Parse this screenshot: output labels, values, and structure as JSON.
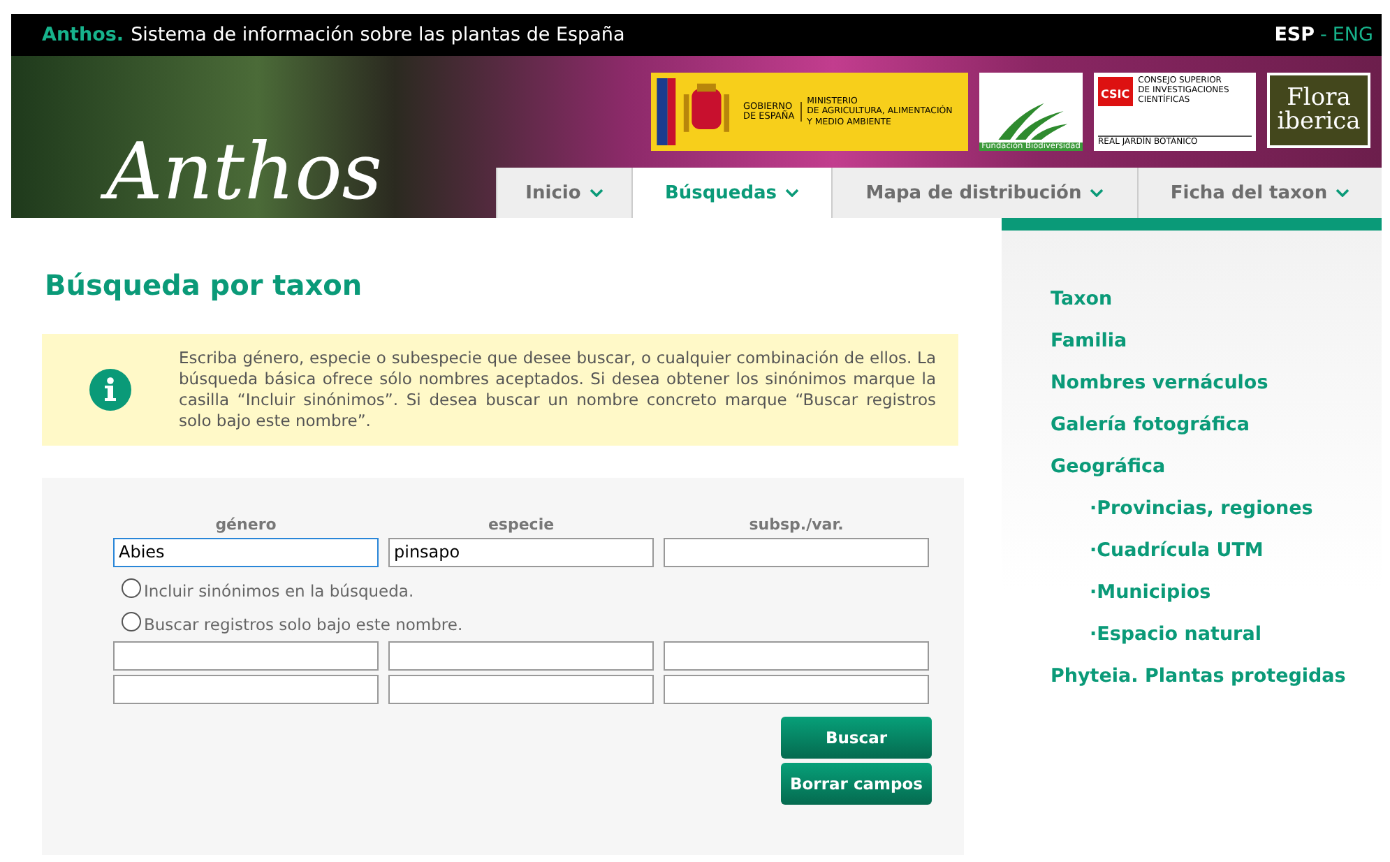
{
  "top_bar": {
    "brand": "Anthos.",
    "tagline": "Sistema de información sobre las plantas de España",
    "languages": [
      {
        "label": "ESP",
        "selected": true
      },
      {
        "label": "ENG",
        "selected": false
      }
    ],
    "separator": "-"
  },
  "banner": {
    "script_title": "Anthos",
    "logos": [
      {
        "kind": "gobierno",
        "lines": [
          "GOBIERNO",
          "DE ESPAÑA"
        ],
        "ministry": [
          "MINISTERIO",
          "DE AGRICULTURA, ALIMENTACIÓN",
          "Y MEDIO AMBIENTE"
        ]
      },
      {
        "kind": "fundacion",
        "caption": "Fundación Biodiversidad"
      },
      {
        "kind": "csic",
        "badge": "CSIC",
        "lines": [
          "CONSEJO SUPERIOR",
          "DE INVESTIGACIONES",
          "CIENTÍFICAS"
        ],
        "caption": "REAL JARDÍN BOTÁNICO"
      },
      {
        "kind": "flora",
        "lines": [
          "Flora",
          "iberica"
        ]
      }
    ]
  },
  "nav": [
    {
      "label": "Inicio",
      "selected": false
    },
    {
      "label": "Búsquedas",
      "selected": true
    },
    {
      "label": "Mapa de distribución",
      "selected": false
    },
    {
      "label": "Ficha del taxon",
      "selected": false
    }
  ],
  "heading": "Búsqueda por taxon",
  "info": "Escriba género, especie o subespecie que desee buscar, o cualquier combinación de ellos. La búsqueda básica ofrece sólo nombres aceptados. Si desea obtener los sinónimos marque la casilla “Incluir sinónimos”. Si desea buscar un nombre concreto marque “Buscar registros solo bajo este nombre”.",
  "form": {
    "columns": [
      "género",
      "especie",
      "subsp./var."
    ],
    "rows": [
      {
        "kind": "fields",
        "fields": [
          {
            "value": "Abies",
            "focused": true
          },
          {
            "value": "pinsapo",
            "focused": false
          },
          {
            "focused": false
          }
        ]
      },
      {
        "kind": "radio",
        "label": "Incluir sinónimos en la búsqueda.",
        "checked": false
      },
      {
        "kind": "radio",
        "label": "Buscar registros solo bajo este nombre.",
        "checked": false
      },
      {
        "kind": "fields",
        "fields": [
          {
            "focused": false
          },
          {
            "focused": false
          },
          {
            "focused": false
          }
        ]
      },
      {
        "kind": "fields",
        "fields": [
          {
            "focused": false
          },
          {
            "focused": false
          },
          {
            "focused": false
          }
        ]
      }
    ],
    "buttons": [
      "Buscar",
      "Borrar campos"
    ]
  },
  "sidebar": {
    "items": [
      {
        "label": "Taxon"
      },
      {
        "label": "Familia"
      },
      {
        "label": "Nombres vernáculos"
      },
      {
        "label": "Galería fotográfica"
      },
      {
        "label": "Geográfica",
        "children": [
          {
            "label": "·Provincias, regiones"
          },
          {
            "label": "·Cuadrícula UTM"
          },
          {
            "label": "·Municipios"
          },
          {
            "label": "·Espacio natural"
          }
        ]
      },
      {
        "label": "Phyteia. Plantas protegidas"
      }
    ]
  }
}
